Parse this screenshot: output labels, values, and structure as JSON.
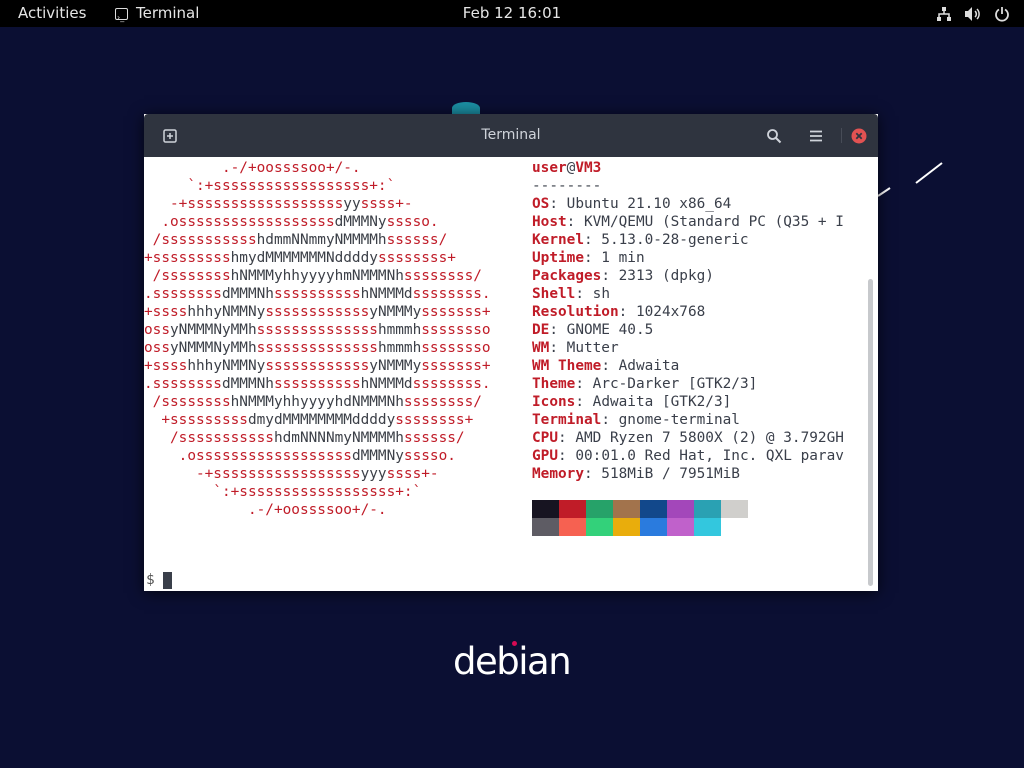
{
  "topbar": {
    "activities": "Activities",
    "app_name": "Terminal",
    "clock": "Feb 12  16:01",
    "icons": [
      "network-icon",
      "volume-icon",
      "power-icon"
    ]
  },
  "window": {
    "title": "Terminal",
    "buttons": [
      "new-tab-icon",
      "search-icon",
      "menu-icon",
      "close-icon"
    ]
  },
  "logo_lines": [
    "         .-/+oossssoo+/-.",
    "     `:+ssssssssssssssssss+:`",
    "   -+ssssssssssssssssssyyssss+-",
    "  .ossssssssssssssssssdMMMNysssso.",
    " /ssssssssssshdmmNNmmyNMMMMhssssss/",
    "+ssssssssshmydMMMMMMMNddddyssssssss+",
    " /sssssssshNMMMyhhyyyyhmNMMMNhssssssss/",
    ".ssssssssdMMMNhsssssssssshNMMMdssssssss.",
    "+sssshhhyNMMNyssssssssssssyNMMMysssssss+",
    "ossyNMMMNyMMhsssssssssssssshmmmhssssssso",
    "ossyNMMMNyMMhsssssssssssssshmmmhssssssso",
    "+sssshhhyNMMNyssssssssssssyNMMMysssssss+",
    ".ssssssssdMMMNhsssssssssshNMMMdssssssss.",
    " /sssssssshNMMMyhhyyyyhdNMMMNhssssssss/",
    "  +sssssssssdmydMMMMMMMMddddyssssssss+",
    "   /ssssssssssshdmNNNNmyNMMMMhssssss/",
    "    .ossssssssssssssssssdMMMNysssso.",
    "      -+sssssssssssssssssyyyssss+-",
    "        `:+ssssssssssssssssss+:`",
    "            .-/+oossssoo+/-."
  ],
  "info": {
    "user": "user",
    "at": "@",
    "host": "VM3",
    "separator": "--------",
    "rows": [
      {
        "label": "OS",
        "value": ": Ubuntu 21.10 x86_64"
      },
      {
        "label": "Host",
        "value": ": KVM/QEMU (Standard PC (Q35 + I"
      },
      {
        "label": "Kernel",
        "value": ": 5.13.0-28-generic"
      },
      {
        "label": "Uptime",
        "value": ": 1 min"
      },
      {
        "label": "Packages",
        "value": ": 2313 (dpkg)"
      },
      {
        "label": "Shell",
        "value": ": sh"
      },
      {
        "label": "Resolution",
        "value": ": 1024x768"
      },
      {
        "label": "DE",
        "value": ": GNOME 40.5"
      },
      {
        "label": "WM",
        "value": ": Mutter"
      },
      {
        "label": "WM Theme",
        "value": ": Adwaita"
      },
      {
        "label": "Theme",
        "value": ": Arc-Darker [GTK2/3]"
      },
      {
        "label": "Icons",
        "value": ": Adwaita [GTK2/3]"
      },
      {
        "label": "Terminal",
        "value": ": gnome-terminal"
      },
      {
        "label": "CPU",
        "value": ": AMD Ryzen 7 5800X (2) @ 3.792GH"
      },
      {
        "label": "GPU",
        "value": ": 00:01.0 Red Hat, Inc. QXL parav"
      },
      {
        "label": "Memory",
        "value": ": 518MiB / 7951MiB"
      }
    ]
  },
  "palette": {
    "row1": [
      "#171421",
      "#c01c28",
      "#26a269",
      "#a2734c",
      "#12488b",
      "#a347ba",
      "#2aa1b3",
      "#d0cfcc"
    ],
    "row2": [
      "#5e5c64",
      "#f66151",
      "#33d17a",
      "#e9ad0c",
      "#2a7bde",
      "#c061cb",
      "#33c7de",
      "#ffffff"
    ]
  },
  "prompt": "$",
  "desktop": {
    "logo_text": "debian"
  }
}
